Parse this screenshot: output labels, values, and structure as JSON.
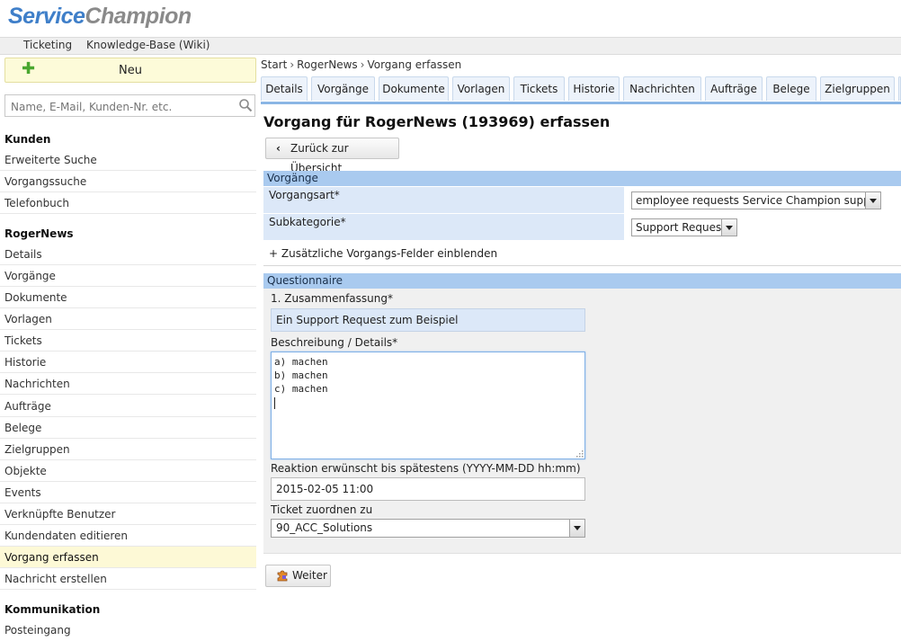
{
  "logo": {
    "part1": "Service",
    "part2": "Champion"
  },
  "topnav": [
    "Ticketing",
    "Knowledge-Base (Wiki)"
  ],
  "sidebar": {
    "new_label": "Neu",
    "search_placeholder": "Name, E-Mail, Kunden-Nr. etc.",
    "groups": [
      {
        "title": "Kunden",
        "items": [
          "Erweiterte Suche",
          "Vorgangssuche",
          "Telefonbuch"
        ]
      },
      {
        "title": "RogerNews",
        "items": [
          "Details",
          "Vorgänge",
          "Dokumente",
          "Vorlagen",
          "Tickets",
          "Historie",
          "Nachrichten",
          "Aufträge",
          "Belege",
          "Zielgruppen",
          "Objekte",
          "Events",
          "Verknüpfte Benutzer",
          "Kundendaten editieren",
          "Vorgang erfassen",
          "Nachricht erstellen"
        ]
      },
      {
        "title": "Kommunikation",
        "items": [
          "Posteingang"
        ]
      }
    ],
    "active_item": "Vorgang erfassen"
  },
  "breadcrumb": [
    "Start",
    "RogerNews",
    "Vorgang erfassen"
  ],
  "tabs": [
    "Details",
    "Vorgänge",
    "Dokumente",
    "Vorlagen",
    "Tickets",
    "Historie",
    "Nachrichten",
    "Aufträge",
    "Belege",
    "Zielgruppen"
  ],
  "page_title": "Vorgang für RogerNews (193969) erfassen",
  "back_button": "Zurück zur Übersicht",
  "vorgaenge": {
    "header": "Vorgänge",
    "vorgangsart_label": "Vorgangsart*",
    "vorgangsart_value": "employee requests Service Champion support",
    "subkategorie_label": "Subkategorie*",
    "subkategorie_value": "Support Request",
    "add_fields": "+ Zusätzliche Vorgangs-Felder einblenden"
  },
  "questionnaire": {
    "header": "Questionnaire",
    "summary_label": "1. Zusammenfassung*",
    "summary_value": "Ein Support Request zum Beispiel",
    "description_label": "Beschreibung / Details*",
    "description_lines": [
      "a) machen",
      "b) machen",
      "c) machen"
    ],
    "reaction_label": "Reaktion erwünscht bis spätestens (YYYY-MM-DD hh:mm)",
    "reaction_value": "2015-02-05 11:00",
    "ticket_label": "Ticket zuordnen zu",
    "ticket_value": "90_ACC_Solutions"
  },
  "next_button": "Weiter",
  "colors": {
    "section_header": "#a9caef",
    "label_bg": "#dce8f8",
    "active_item": "#fdf9d6",
    "logo_blue": "#3f7fc9"
  }
}
